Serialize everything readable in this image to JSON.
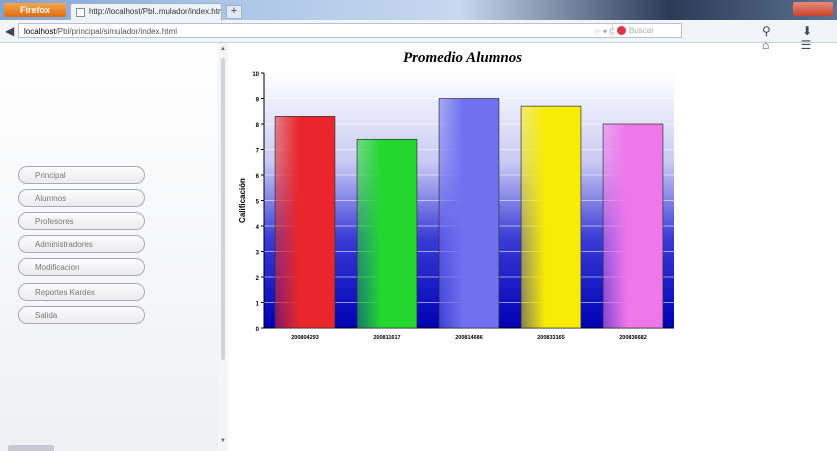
{
  "browser": {
    "app_button": "Firefox",
    "tab_title": "http://localhost/Pbl..mulador/index.html",
    "new_tab": "+",
    "url_host": "localhost",
    "url_path": "/Pbl/principal/simulador/index.html",
    "url_controls": "☆ ▾ C",
    "search_placeholder": "Buscar",
    "toolbar_icons": "⚲ ⬇ ⌂ ☰"
  },
  "sidebar": {
    "items": [
      {
        "label": "Principal"
      },
      {
        "label": "Alumnos"
      },
      {
        "label": "Profesores"
      },
      {
        "label": "Administradores"
      },
      {
        "label": "Modificacion"
      },
      {
        "label": "Reportes Kardex"
      },
      {
        "label": "Salida"
      }
    ]
  },
  "chart_data": {
    "type": "bar",
    "title": "Promedio Alumnos",
    "ylabel": "Calificación",
    "xlabel": "",
    "ylim": [
      0,
      10
    ],
    "yticks": [
      0,
      1,
      2,
      3,
      4,
      5,
      6,
      7,
      8,
      9,
      10
    ],
    "categories": [
      "200804293",
      "200811617",
      "200814686",
      "200833165",
      "200836682"
    ],
    "values": [
      8.3,
      7.4,
      9.0,
      8.7,
      8.0
    ],
    "colors": [
      "#e8262b",
      "#22d82f",
      "#6f71f0",
      "#f6ec06",
      "#ee77ea"
    ],
    "grid": true,
    "legend": "none"
  }
}
